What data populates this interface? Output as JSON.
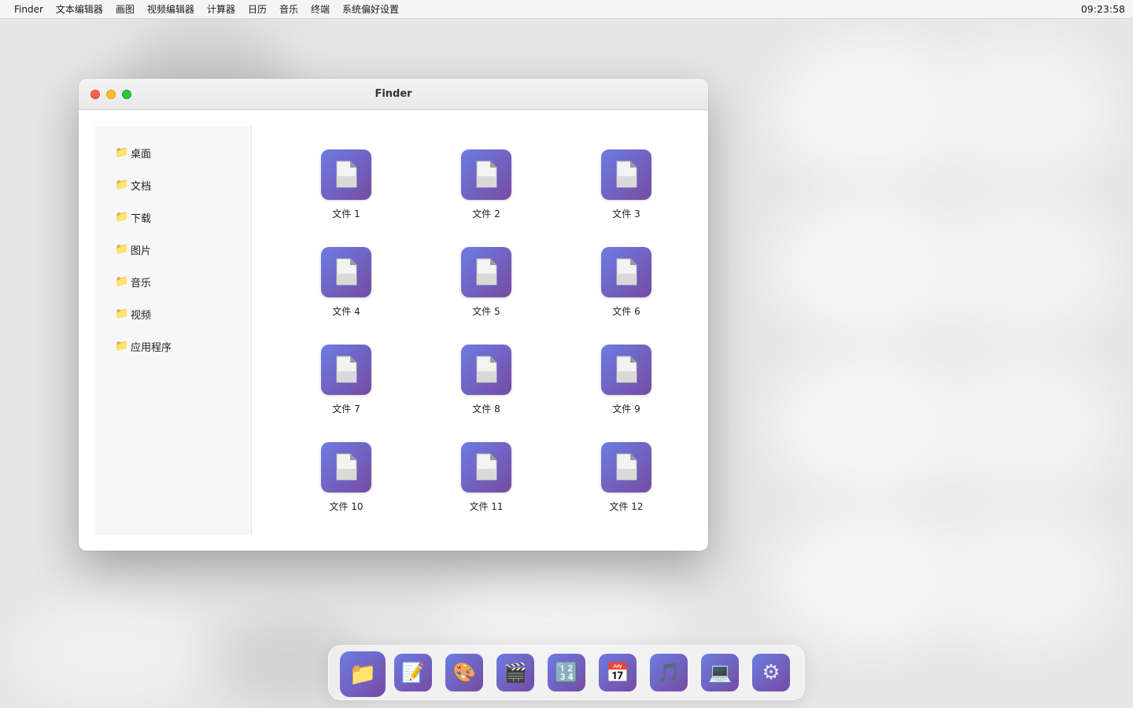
{
  "menubar": {
    "items": [
      "Finder",
      "文本编辑器",
      "画图",
      "视频编辑器",
      "计算器",
      "日历",
      "音乐",
      "终端",
      "系统偏好设置"
    ],
    "clock": "09:23:58"
  },
  "window": {
    "title": "Finder",
    "sidebar": [
      {
        "icon": "folder-icon",
        "label": "桌面"
      },
      {
        "icon": "folder-icon",
        "label": "文档"
      },
      {
        "icon": "folder-icon",
        "label": "下载"
      },
      {
        "icon": "folder-icon",
        "label": "图片"
      },
      {
        "icon": "folder-icon",
        "label": "音乐"
      },
      {
        "icon": "folder-icon",
        "label": "视频"
      },
      {
        "icon": "folder-icon",
        "label": "应用程序"
      }
    ],
    "files": [
      {
        "icon": "document-icon",
        "label": "文件 1"
      },
      {
        "icon": "document-icon",
        "label": "文件 2"
      },
      {
        "icon": "document-icon",
        "label": "文件 3"
      },
      {
        "icon": "document-icon",
        "label": "文件 4"
      },
      {
        "icon": "document-icon",
        "label": "文件 5"
      },
      {
        "icon": "document-icon",
        "label": "文件 6"
      },
      {
        "icon": "document-icon",
        "label": "文件 7"
      },
      {
        "icon": "document-icon",
        "label": "文件 8"
      },
      {
        "icon": "document-icon",
        "label": "文件 9"
      },
      {
        "icon": "document-icon",
        "label": "文件 10"
      },
      {
        "icon": "document-icon",
        "label": "文件 11"
      },
      {
        "icon": "document-icon",
        "label": "文件 12"
      }
    ]
  },
  "dock": {
    "apps": [
      {
        "name": "finder",
        "icon": "folder-icon",
        "glyph": "📁",
        "active": true
      },
      {
        "name": "text-editor",
        "icon": "memo-icon",
        "glyph": "📝"
      },
      {
        "name": "paint",
        "icon": "palette-icon",
        "glyph": "🎨"
      },
      {
        "name": "video-editor",
        "icon": "clapper-icon",
        "glyph": "🎬"
      },
      {
        "name": "calculator",
        "icon": "numbers-icon",
        "glyph": "🔢"
      },
      {
        "name": "calendar",
        "icon": "calendar-icon",
        "glyph": "📅"
      },
      {
        "name": "music",
        "icon": "music-note-icon",
        "glyph": "🎵"
      },
      {
        "name": "terminal",
        "icon": "laptop-icon",
        "glyph": "💻"
      },
      {
        "name": "system-preferences",
        "icon": "gear-icon",
        "glyph": "⚙"
      }
    ]
  },
  "colors": {
    "icon_gradient_start": "#6c7ce3",
    "icon_gradient_end": "#764ba2",
    "close": "#ff5f57",
    "minimize": "#febc2e",
    "maximize": "#28c840"
  }
}
